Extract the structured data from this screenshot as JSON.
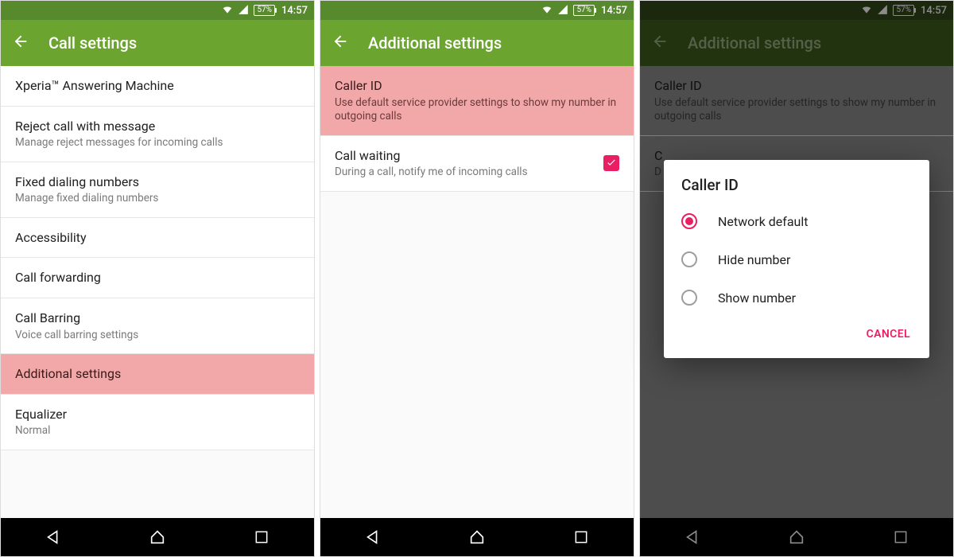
{
  "status": {
    "battery": "57%",
    "time": "14:57"
  },
  "screen1": {
    "title": "Call settings",
    "items": [
      {
        "primary": "Xperia™ Answering Machine",
        "secondary": ""
      },
      {
        "primary": "Reject call with message",
        "secondary": "Manage reject messages for incoming calls"
      },
      {
        "primary": "Fixed dialing numbers",
        "secondary": "Manage fixed dialing numbers"
      },
      {
        "primary": "Accessibility",
        "secondary": ""
      },
      {
        "primary": "Call forwarding",
        "secondary": ""
      },
      {
        "primary": "Call Barring",
        "secondary": "Voice call barring settings"
      },
      {
        "primary": "Additional settings",
        "secondary": ""
      },
      {
        "primary": "Equalizer",
        "secondary": "Normal"
      }
    ]
  },
  "screen2": {
    "title": "Additional settings",
    "items": [
      {
        "primary": "Caller ID",
        "secondary": "Use default service provider settings to show my number in outgoing calls"
      },
      {
        "primary": "Call waiting",
        "secondary": "During a call, notify me of incoming calls"
      }
    ]
  },
  "screen3": {
    "title": "Additional settings",
    "items": [
      {
        "primary": "Caller ID",
        "secondary": "Use default service provider settings to show my number in outgoing calls"
      },
      {
        "primary": "C",
        "secondary": "D"
      }
    ],
    "dialog": {
      "title": "Caller ID",
      "options": [
        "Network default",
        "Hide number",
        "Show number"
      ],
      "selected": 0,
      "cancel": "CANCEL"
    }
  }
}
